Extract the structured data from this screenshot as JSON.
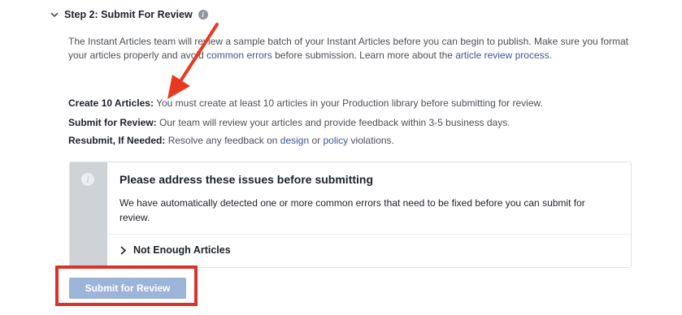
{
  "step": {
    "title": "Step 2: Submit For Review",
    "info_icon": "info-circle-icon",
    "expand_icon": "chevron-down-icon"
  },
  "description": {
    "part1": "The Instant Articles team will review a sample batch of your Instant Articles before you can begin to publish. Make sure you format your articles properly and avoid ",
    "link1": "common errors",
    "part2": " before submission. Learn more about the ",
    "link2": "article review process",
    "part3": "."
  },
  "requirements": [
    {
      "label": "Create 10 Articles:",
      "text": " You must create at least 10 articles in your Production library before submitting for review."
    },
    {
      "label": "Submit for Review:",
      "text": " Our team will review your articles and provide feedback within 3-5 business days."
    },
    {
      "label": "Resubmit, If Needed:",
      "text": " Resolve any feedback on ",
      "link1": "design",
      "mid": " or ",
      "link2": "policy",
      "end": " violations."
    }
  ],
  "alert": {
    "icon": "info-icon",
    "title": "Please address these issues before submitting",
    "body": "We have automatically detected one or more common errors that need to be fixed before you can submit for review.",
    "issue_label": "Not Enough Articles",
    "issue_icon": "chevron-right-icon"
  },
  "submit_button": {
    "label": "Submit for Review",
    "disabled": true
  },
  "colors": {
    "link": "#365899",
    "button_disabled": "#9cb4d8",
    "annotation_red": "#d9322a",
    "alert_side": "#cfd2d6"
  }
}
